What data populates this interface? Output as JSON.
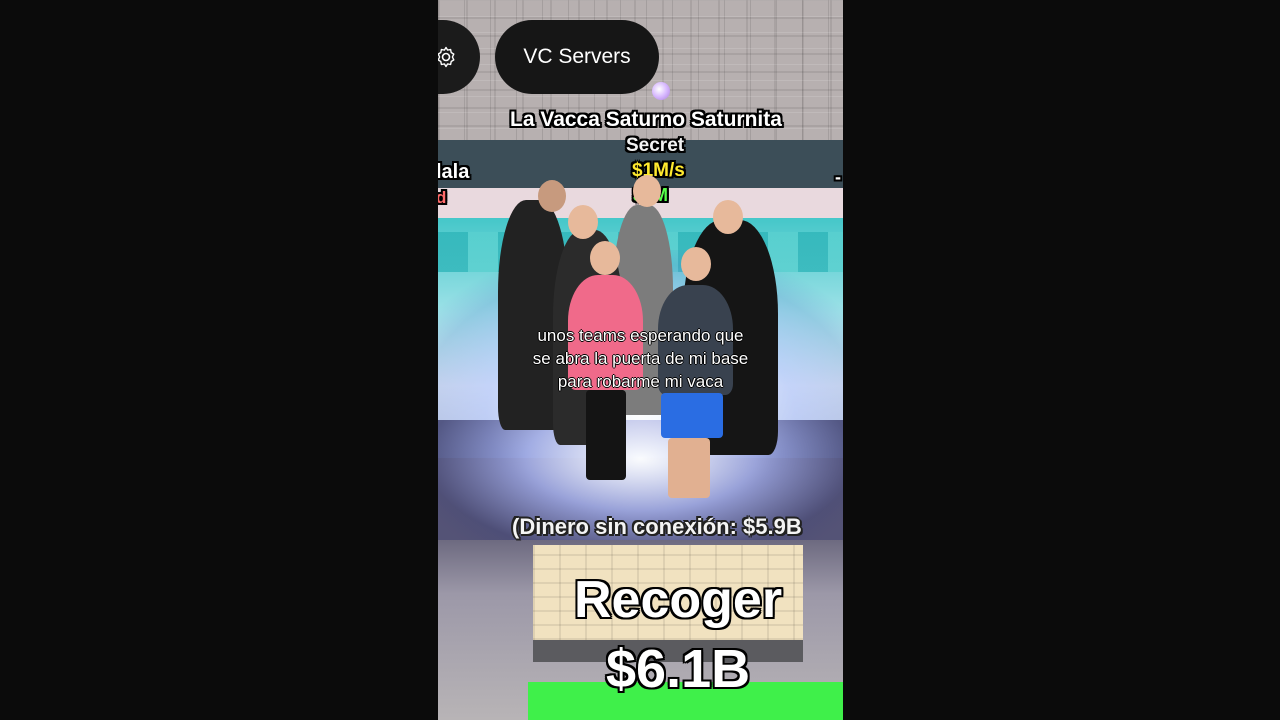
{
  "top_buttons": {
    "settings_icon": "gear-icon",
    "vc_servers_label": "VC Servers"
  },
  "pet_display": {
    "name": "La Vacca Saturno Saturnita",
    "rarity": "Secret",
    "rate": "$1M/s",
    "price_visible": "$0M"
  },
  "side_labels": {
    "left_name": "lala",
    "left_tag": "d",
    "right_mark": "-"
  },
  "subtitle": {
    "line1": "unos teams esperando que",
    "line2": "se abra la puerta de mi base",
    "line3": "para robarme mi vaca"
  },
  "offline_money": "(Dinero sin conexión: $5.9B",
  "collect": {
    "label": "Recoger",
    "amount": "$6.1B"
  },
  "colors": {
    "rate": "#ffe92e",
    "price": "#57ff4a",
    "collect_pad": "#3ff04a",
    "button_bg": "#161616"
  }
}
